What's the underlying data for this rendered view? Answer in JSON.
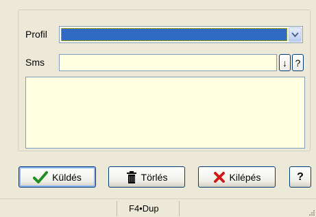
{
  "form": {
    "profil_label": "Profil",
    "sms_label": "Sms",
    "profil_value": "",
    "sms_value": "",
    "message_value": "",
    "down_button": "↓",
    "help_small_button": "?"
  },
  "buttons": {
    "send": "Küldés",
    "delete": "Törlés",
    "exit": "Kilépés",
    "help": "?"
  },
  "status": {
    "text": "F4•Dup"
  },
  "colors": {
    "selection": "#316AC5",
    "input_bg": "#FFFFE1",
    "window_bg": "#ECE9D8"
  }
}
